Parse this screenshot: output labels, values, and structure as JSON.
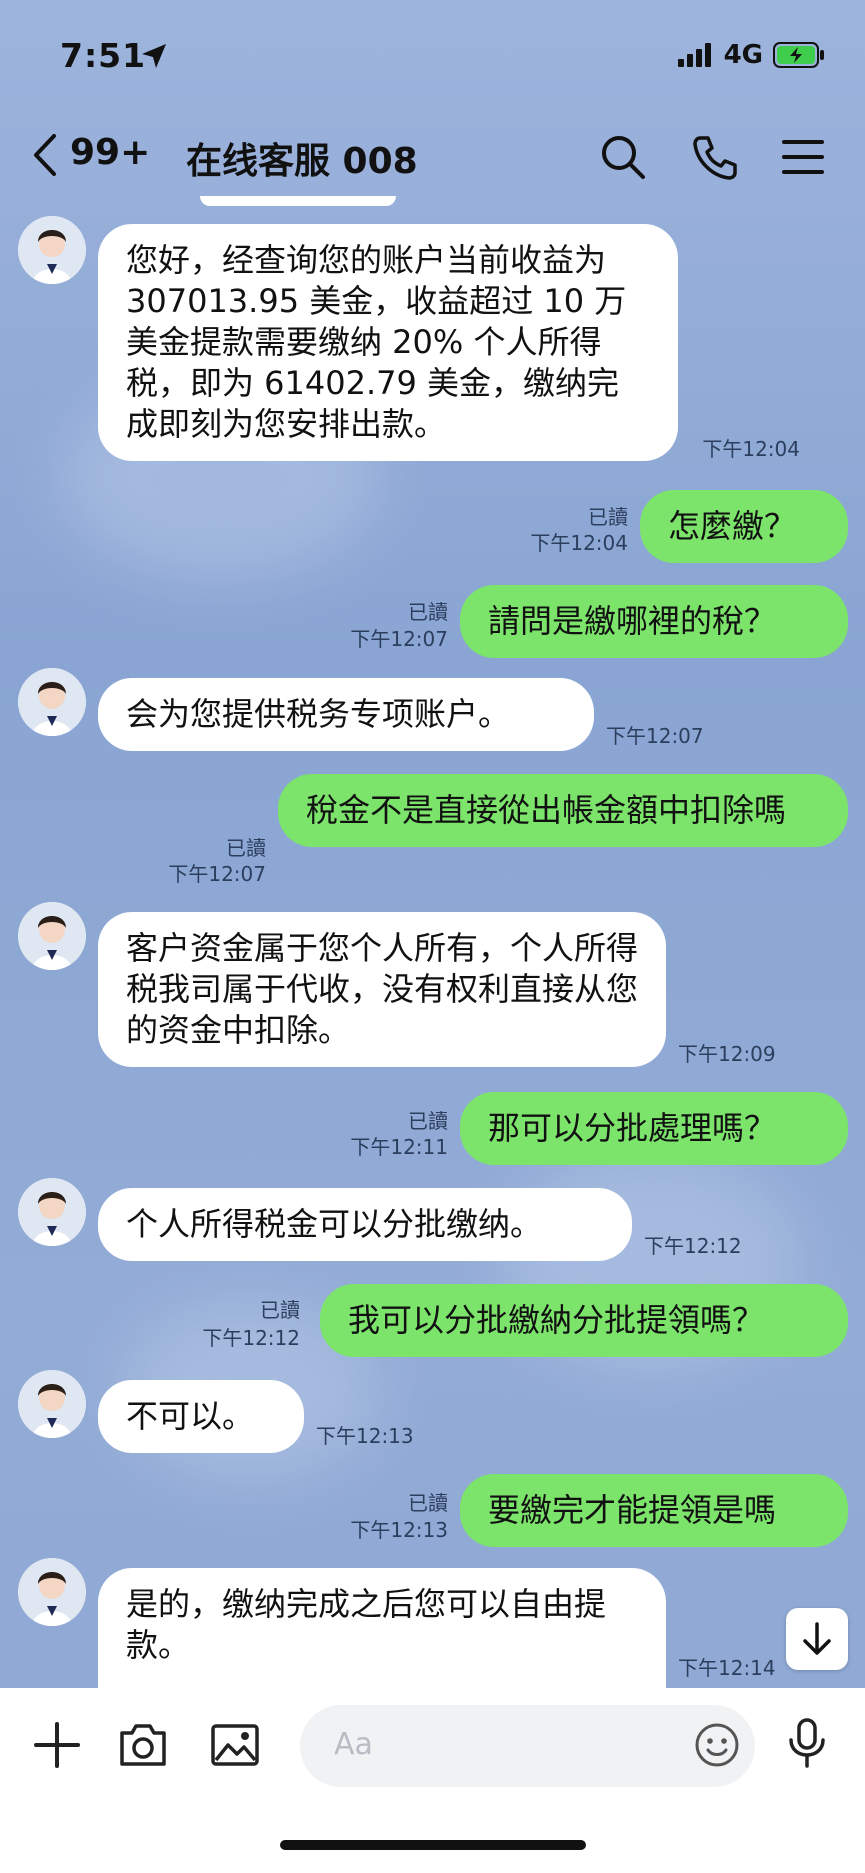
{
  "status_bar": {
    "time": "7:51",
    "network": "4G"
  },
  "header": {
    "unread_count": "99+",
    "title": "在线客服 008"
  },
  "messages": [
    {
      "side": "in",
      "text": "您好，经查询您的账户当前收益为 307013.95 美金，收益超过 10 万美金提款需要缴纳 20% 个人所得税，即为 61402.79 美金，缴纳完成即刻为您安排出款。",
      "time": "下午12:04"
    },
    {
      "side": "out",
      "text": "怎麼繳？",
      "time": "下午12:04",
      "read": "已讀"
    },
    {
      "side": "out",
      "text": "請問是繳哪裡的稅？",
      "time": "下午12:07",
      "read": "已讀"
    },
    {
      "side": "in",
      "text": "会为您提供税务专项账户。",
      "time": "下午12:07"
    },
    {
      "side": "out",
      "text": "稅金不是直接從出帳金額中扣除嗎",
      "time": "下午12:07",
      "read": "已讀"
    },
    {
      "side": "in",
      "text": "客户资金属于您个人所有，个人所得税我司属于代收，没有权利直接从您的资金中扣除。",
      "time": "下午12:09"
    },
    {
      "side": "out",
      "text": "那可以分批處理嗎？",
      "time": "下午12:11",
      "read": "已讀"
    },
    {
      "side": "in",
      "text": "个人所得税金可以分批缴纳。",
      "time": "下午12:12"
    },
    {
      "side": "out",
      "text": "我可以分批繳納分批提領嗎？",
      "time": "下午12:12",
      "read": "已讀"
    },
    {
      "side": "in",
      "text": "不可以。",
      "time": "下午12:13"
    },
    {
      "side": "out",
      "text": "要繳完才能提領是嗎",
      "time": "下午12:13",
      "read": "已讀"
    },
    {
      "side": "in",
      "text": "是的，缴纳完成之后您可以自由提款。",
      "time": "下午12:14"
    }
  ],
  "composer": {
    "placeholder": "Aa"
  },
  "colors": {
    "outgoing_bubble": "#7ce36b",
    "incoming_bubble": "#ffffff",
    "chat_background": "#8fa9d4"
  }
}
